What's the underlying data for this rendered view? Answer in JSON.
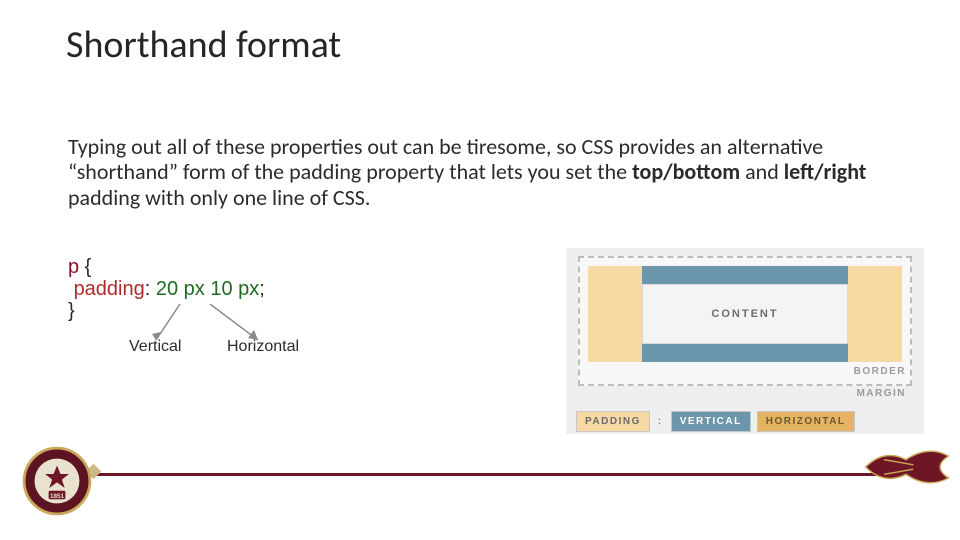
{
  "title": "Shorthand format",
  "paragraph": {
    "pre": "Typing out all of these properties out can be tiresome, so CSS provides an alternative “shorthand” form of the padding property that lets you set the ",
    "bold1": "top/bottom",
    "mid": " and ",
    "bold2": "left/right",
    "post": " padding with only one line of CSS."
  },
  "code": {
    "selector": "p",
    "open": " {",
    "prop": "padding",
    "colon": ": ",
    "val": "20 px 10 px",
    "semicolon": ";",
    "close": "}"
  },
  "annotations": {
    "vertical": "Vertical",
    "horizontal": "Horizontal"
  },
  "diagram": {
    "content": "CONTENT",
    "border": "BORDER",
    "margin": "MARGIN",
    "legend_padding": "PADDING",
    "legend_colon": ":",
    "legend_vertical": "VERTICAL",
    "legend_horizontal": "HORIZONTAL"
  },
  "seal_year": "1851"
}
